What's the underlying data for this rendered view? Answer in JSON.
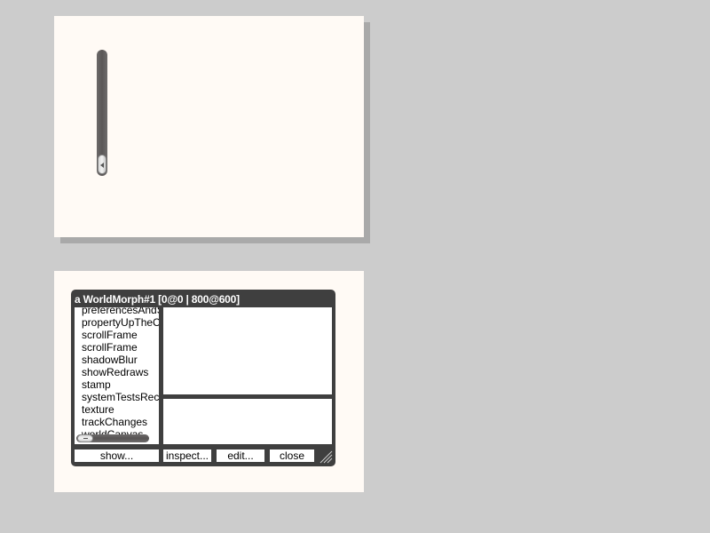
{
  "inspector": {
    "title": "a WorldMorph#1 [0@0 | 800@600]",
    "list_items": [
      "preferencesAndSettings",
      "propertyUpTheChain",
      "scrollFrame",
      "scrollFrame",
      "shadowBlur",
      "showRedraws",
      "stamp",
      "systemTestsRecorder",
      "texture",
      "trackChanges",
      "worldCanvas"
    ],
    "buttons": {
      "show": "show...",
      "inspect": "inspect...",
      "edit": "edit...",
      "close": "close"
    }
  },
  "colors": {
    "desktop": "#cccccc",
    "panel": "#fffaf5",
    "window_frame": "#3f3f3f",
    "slider_track": "#5f5c5c"
  },
  "icons": {
    "vertical_slider_grip": "left-arrow-icon",
    "horizontal_slider_grip": "dash-icon",
    "resize": "resize-grip-icon"
  }
}
